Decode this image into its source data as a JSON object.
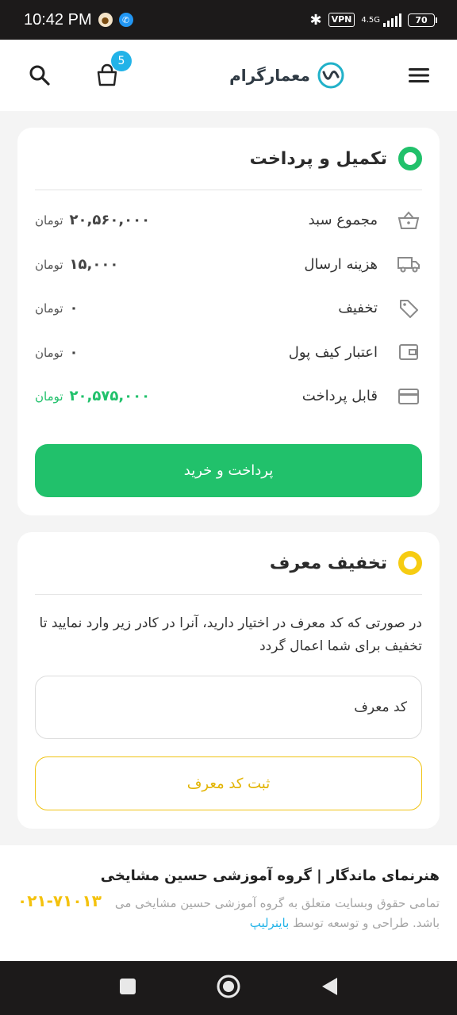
{
  "status_bar": {
    "time": "10:42 PM",
    "vpn": "VPN",
    "network": "4.5G",
    "battery": "70"
  },
  "header": {
    "brand_name": "معمارگرام",
    "cart_count": "5"
  },
  "checkout": {
    "title": "تکمیل و پرداخت",
    "rows": [
      {
        "label": "مجموع سبد",
        "amount": "۲۰,۵۶۰,۰۰۰",
        "unit": "تومان"
      },
      {
        "label": "هزینه ارسال",
        "amount": "۱۵,۰۰۰",
        "unit": "تومان"
      },
      {
        "label": "تخفیف",
        "amount": "۰",
        "unit": "تومان"
      },
      {
        "label": "اعتبار کیف پول",
        "amount": "۰",
        "unit": "تومان"
      },
      {
        "label": "قابل پرداخت",
        "amount": "۲۰,۵۷۵,۰۰۰",
        "unit": "تومان"
      }
    ],
    "pay_button_label": "پرداخت و خرید"
  },
  "referral": {
    "title": "تخفیف معرف",
    "description": "در صورتی که کد معرف در اختیار دارید، آنرا در کادر زیر وارد نمایید تا تخفیف برای شما اعمال گردد",
    "input_placeholder": "کد معرف",
    "submit_label": "ثبت کد معرف"
  },
  "footer": {
    "title": "هنرنمای ماندگار | گروه آموزشی حسین مشایخی",
    "text": "تمامی حقوق وبسایت متعلق به گروه آموزشی حسین مشایخی می باشد. طراحی و توسعه توسط ",
    "link": "باینرلیپ",
    "phone": "۰۲۱-۷۱۰۱۳"
  },
  "colors": {
    "primary_green": "#21c16b",
    "accent_yellow": "#f6cc12",
    "badge_blue": "#22b3e8"
  }
}
